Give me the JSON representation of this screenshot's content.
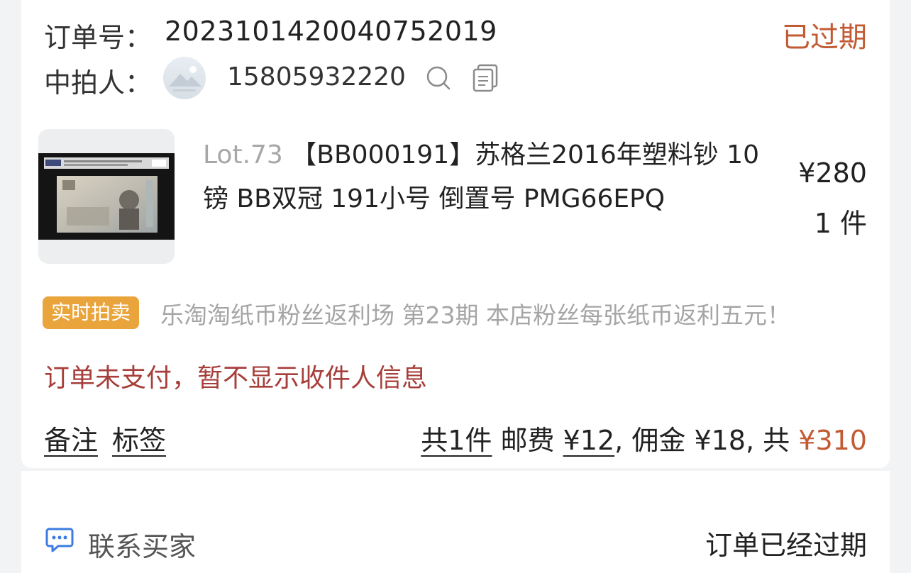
{
  "order": {
    "order_no_label": "订单号：",
    "order_no": "2023101420040752019",
    "status": "已过期",
    "winner_label": "中拍人：",
    "winner_phone": "15805932220"
  },
  "item": {
    "lot": "Lot.73",
    "title": "【BB000191】苏格兰2016年塑料钞 10镑 BB双冠 191小号 倒置号 PMG66EPQ",
    "price": "¥280",
    "quantity": "1 件"
  },
  "session": {
    "badge": "实时拍卖",
    "name": "乐淘淘纸币粉丝返利场 第23期 本店粉丝每张纸币返利五元！"
  },
  "notice": "订单未支付，暂不显示收件人信息",
  "footer": {
    "remark": "备注",
    "tag": "标签",
    "count": "共1件",
    "shipping_label": "邮费",
    "shipping": "¥12",
    "sep1": ",",
    "commission_label": "佣金",
    "commission": "¥18",
    "sep2": ",",
    "total_label": "共",
    "total": "¥310"
  },
  "actions": {
    "contact": "联系买家",
    "expired_text": "订单已经过期"
  },
  "icons": [
    "search-icon",
    "copy-icon",
    "chat-icon"
  ],
  "colors": {
    "status": "#c25a33",
    "badge": "#e9a53b",
    "notice": "#a63e3a",
    "link_blue": "#3d7be0"
  }
}
